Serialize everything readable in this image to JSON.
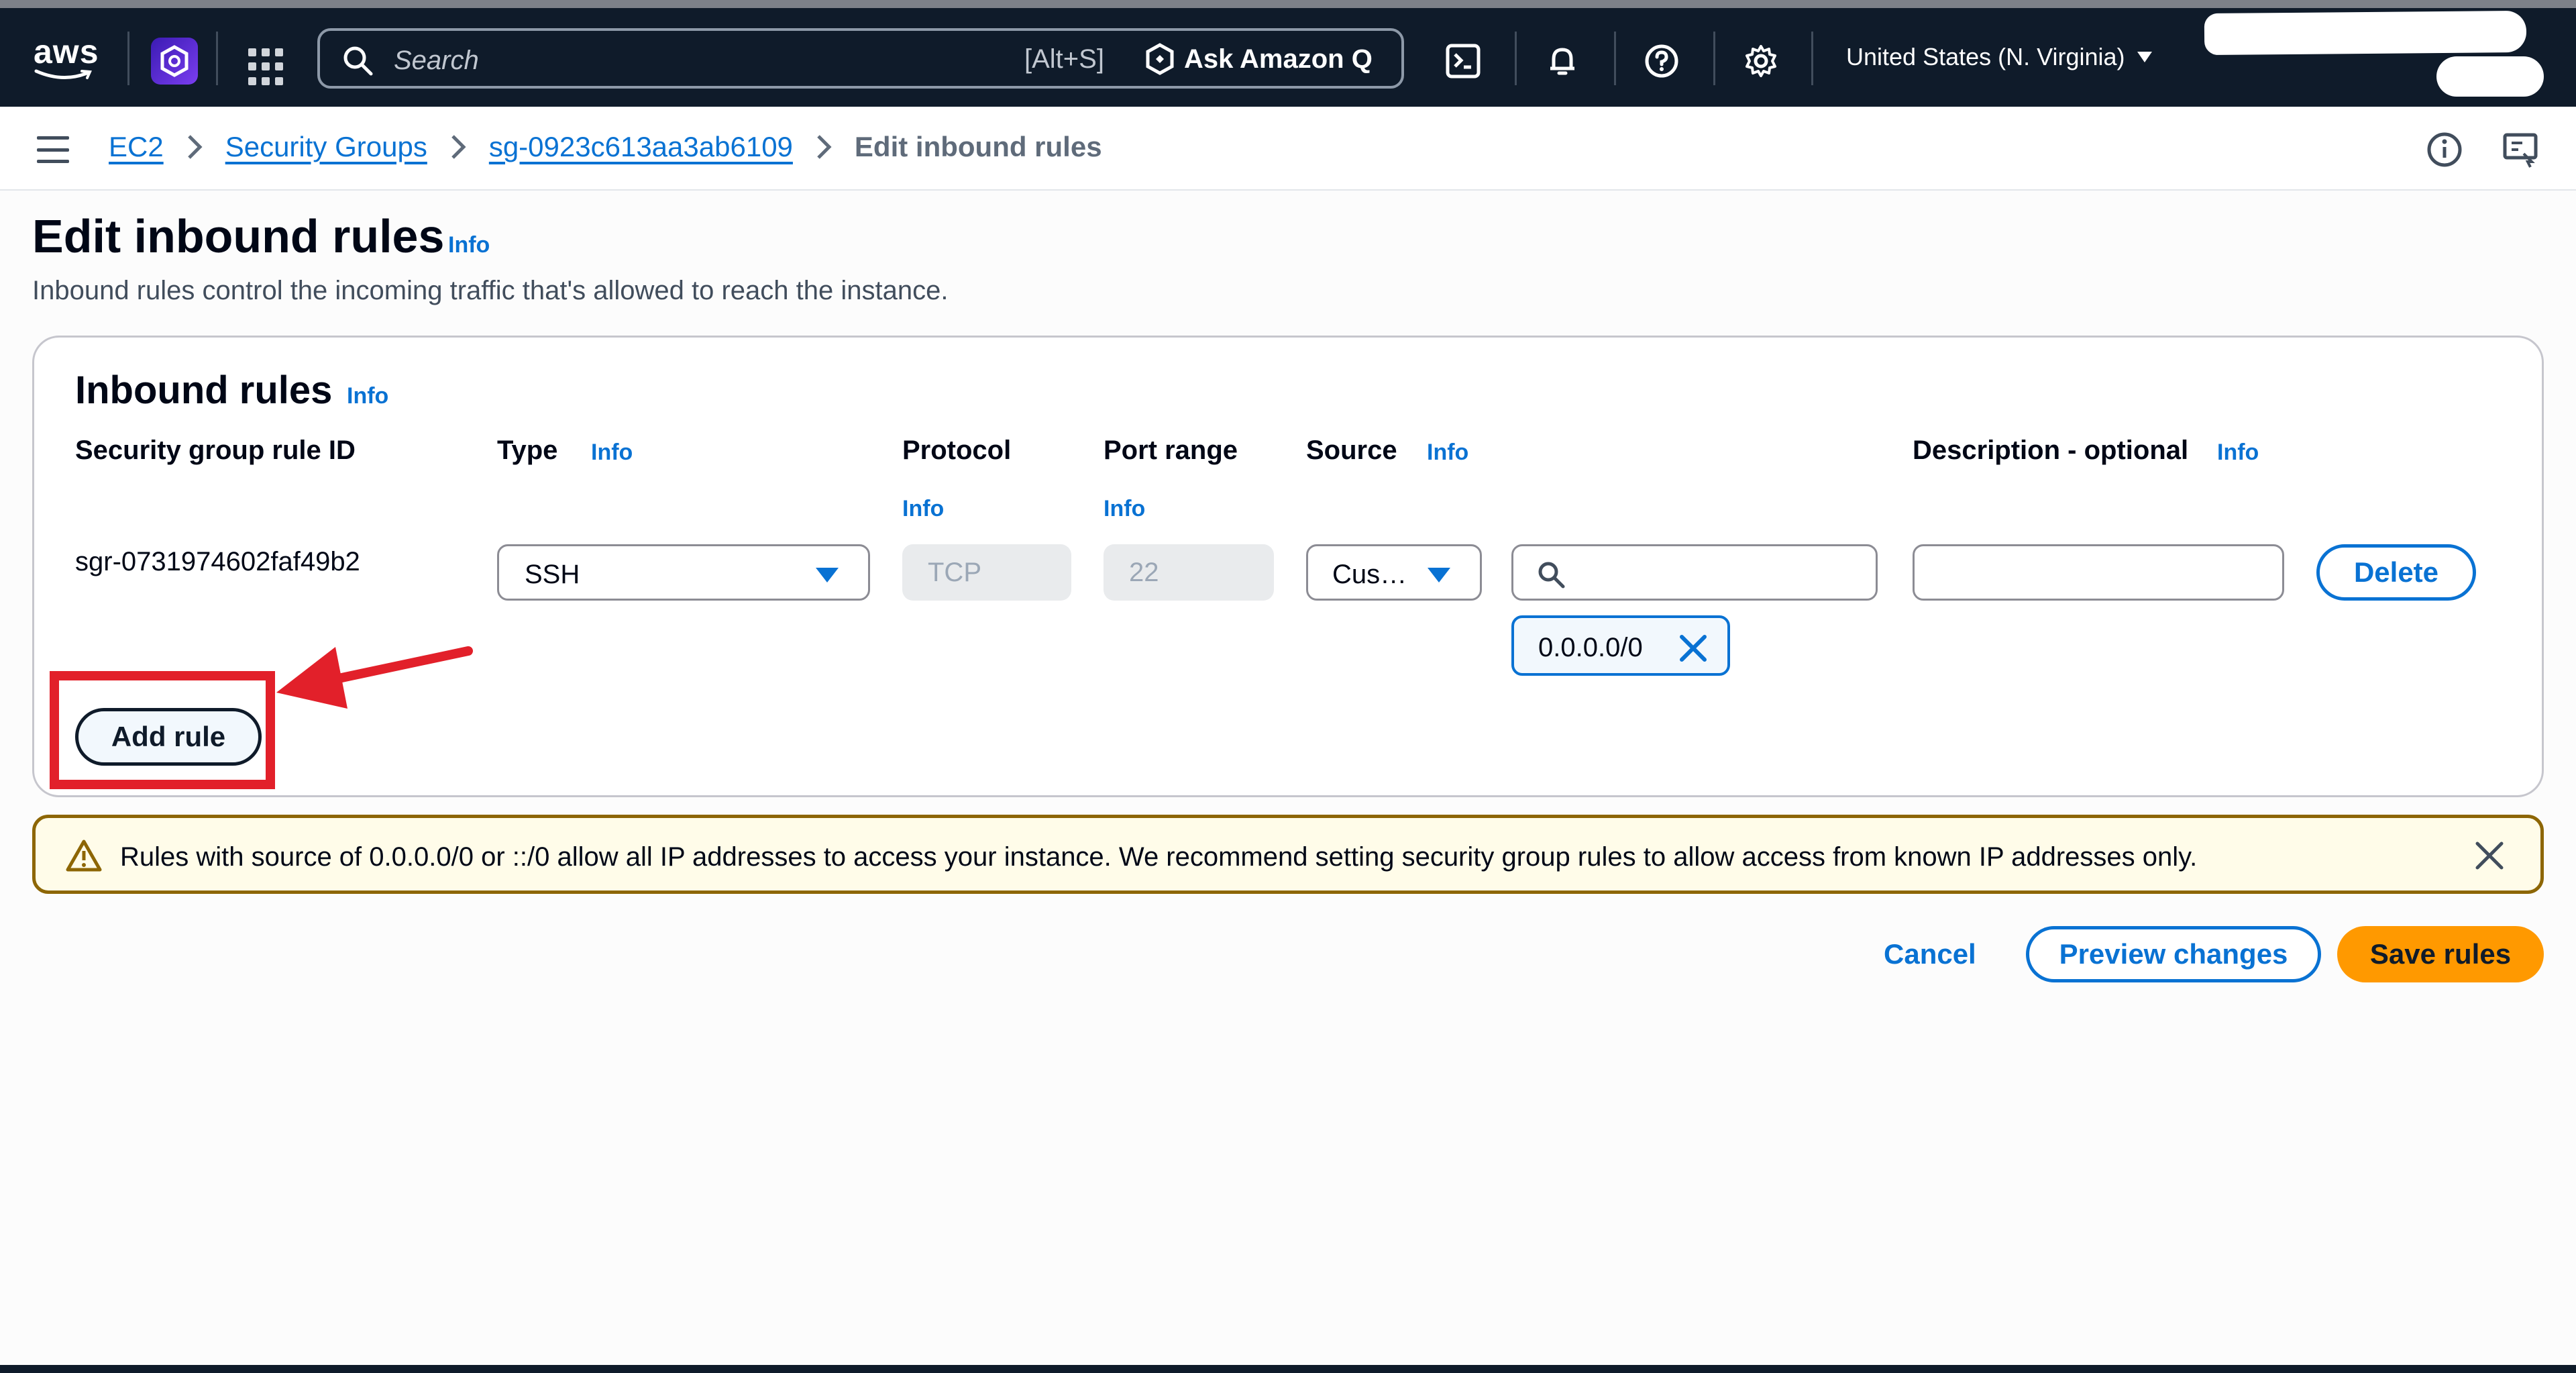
{
  "header": {
    "logo_text": "aws",
    "search": {
      "placeholder": "Search",
      "shortcut": "[Alt+S]"
    },
    "ask_q_label": "Ask Amazon Q",
    "region": "United States (N. Virginia)"
  },
  "breadcrumb": {
    "items": [
      "EC2",
      "Security Groups",
      "sg-0923c613aa3ab6109"
    ],
    "current": "Edit inbound rules"
  },
  "page": {
    "title": "Edit inbound rules",
    "info": "Info",
    "description": "Inbound rules control the incoming traffic that's allowed to reach the instance."
  },
  "panel": {
    "title": "Inbound rules",
    "info": "Info",
    "columns": {
      "rule_id": "Security group rule ID",
      "type": "Type",
      "protocol": "Protocol",
      "port_range": "Port range",
      "source": "Source",
      "description": "Description - optional"
    },
    "info_label": "Info",
    "rule": {
      "id": "sgr-0731974602faf49b2",
      "type": "SSH",
      "protocol": "TCP",
      "port_range": "22",
      "source_type": "Cus…",
      "source_token": "0.0.0.0/0",
      "description_value": ""
    },
    "delete_label": "Delete",
    "add_rule_label": "Add rule"
  },
  "alert": {
    "text": "Rules with source of 0.0.0.0/0 or ::/0 allow all IP addresses to access your instance. We recommend setting security group rules to allow access from known IP addresses only."
  },
  "footer": {
    "cancel_label": "Cancel",
    "preview_label": "Preview changes",
    "save_label": "Save rules"
  },
  "colors": {
    "link": "#0972d3",
    "primary": "#ff9900",
    "header_bg": "#0f1b2a",
    "annotation": "#e2202a",
    "warning_border": "#8d6605"
  }
}
